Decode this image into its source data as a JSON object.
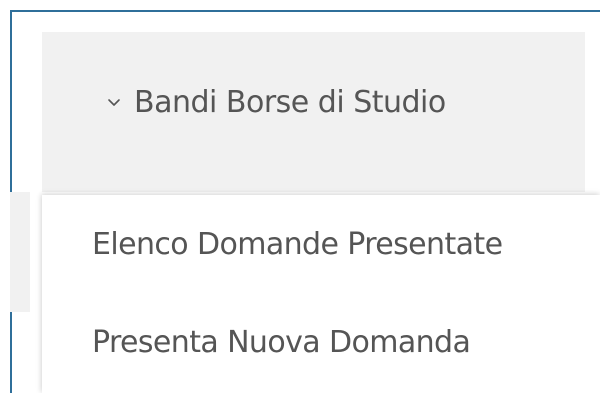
{
  "menu": {
    "title": "Bandi Borse di Studio",
    "toggle_icon": "chevron-down-icon",
    "items": [
      {
        "label": "Elenco Domande Presentate"
      },
      {
        "label": "Presenta Nuova Domanda"
      }
    ]
  },
  "colors": {
    "frame_border": "#2f6f9a",
    "header_background": "#f1f1f1",
    "text": "#555555"
  }
}
